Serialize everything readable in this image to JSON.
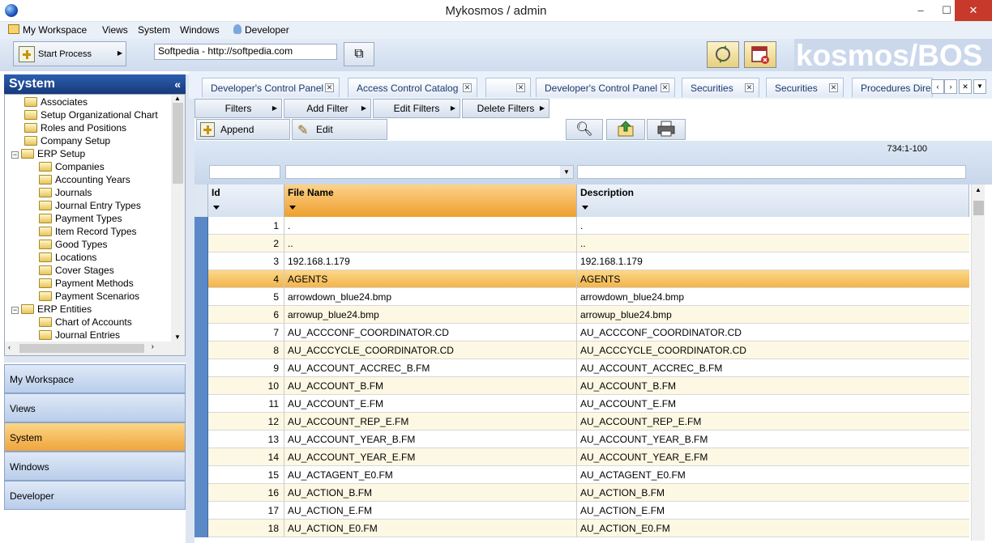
{
  "window": {
    "title": "Mykosmos / admin",
    "minimize": "–",
    "maximize": "☐",
    "close": "✕"
  },
  "menu": [
    "My Workspace",
    "Views",
    "System",
    "Windows",
    "Developer"
  ],
  "toolbar": {
    "start_process": "Start Process",
    "url": "Softpedia - http://softpedia.com",
    "brand": "kosmos/BOS"
  },
  "panel": {
    "title": "System",
    "collapse": "«"
  },
  "tree": [
    {
      "label": "Associates",
      "level": 1
    },
    {
      "label": "Setup Organizational Chart",
      "level": 1
    },
    {
      "label": "Roles and Positions",
      "level": 1
    },
    {
      "label": "Company Setup",
      "level": 1
    },
    {
      "label": "ERP Setup",
      "level": 0,
      "expander": "−"
    },
    {
      "label": "Companies",
      "level": 2
    },
    {
      "label": "Accounting Years",
      "level": 2
    },
    {
      "label": "Journals",
      "level": 2
    },
    {
      "label": "Journal Entry Types",
      "level": 2
    },
    {
      "label": "Payment Types",
      "level": 2
    },
    {
      "label": "Item Record Types",
      "level": 2
    },
    {
      "label": "Good Types",
      "level": 2
    },
    {
      "label": "Locations",
      "level": 2
    },
    {
      "label": "Cover Stages",
      "level": 2
    },
    {
      "label": "Payment Methods",
      "level": 2
    },
    {
      "label": "Payment Scenarios",
      "level": 2
    },
    {
      "label": "ERP Entities",
      "level": 0,
      "expander": "−"
    },
    {
      "label": "Chart of Accounts",
      "level": 2
    },
    {
      "label": "Journal Entries",
      "level": 2
    }
  ],
  "nav": [
    "My Workspace",
    "Views",
    "System",
    "Windows",
    "Developer"
  ],
  "nav_active": "System",
  "tabs": [
    "Developer's Control Panel",
    "Access Control Catalog",
    "",
    "Developer's Control Panel",
    "Securities",
    "Securities",
    "Procedures Directo"
  ],
  "filters": [
    "Filters",
    "Add Filter",
    "Edit Filters",
    "Delete Filters"
  ],
  "actions": {
    "append": "Append",
    "edit": "Edit"
  },
  "row_info": "734:1-100",
  "columns": [
    "Id",
    "File Name",
    "Description"
  ],
  "rows": [
    [
      "1",
      ".",
      "."
    ],
    [
      "2",
      "..",
      ".."
    ],
    [
      "3",
      "192.168.1.179",
      "192.168.1.179"
    ],
    [
      "4",
      "AGENTS",
      "AGENTS"
    ],
    [
      "5",
      "arrowdown_blue24.bmp",
      "arrowdown_blue24.bmp"
    ],
    [
      "6",
      "arrowup_blue24.bmp",
      "arrowup_blue24.bmp"
    ],
    [
      "7",
      "AU_ACCCONF_COORDINATOR.CD",
      "AU_ACCCONF_COORDINATOR.CD"
    ],
    [
      "8",
      "AU_ACCCYCLE_COORDINATOR.CD",
      "AU_ACCCYCLE_COORDINATOR.CD"
    ],
    [
      "9",
      "AU_ACCOUNT_ACCREC_B.FM",
      "AU_ACCOUNT_ACCREC_B.FM"
    ],
    [
      "10",
      "AU_ACCOUNT_B.FM",
      "AU_ACCOUNT_B.FM"
    ],
    [
      "11",
      "AU_ACCOUNT_E.FM",
      "AU_ACCOUNT_E.FM"
    ],
    [
      "12",
      "AU_ACCOUNT_REP_E.FM",
      "AU_ACCOUNT_REP_E.FM"
    ],
    [
      "13",
      "AU_ACCOUNT_YEAR_B.FM",
      "AU_ACCOUNT_YEAR_B.FM"
    ],
    [
      "14",
      "AU_ACCOUNT_YEAR_E.FM",
      "AU_ACCOUNT_YEAR_E.FM"
    ],
    [
      "15",
      "AU_ACTAGENT_E0.FM",
      "AU_ACTAGENT_E0.FM"
    ],
    [
      "16",
      "AU_ACTION_B.FM",
      "AU_ACTION_B.FM"
    ],
    [
      "17",
      "AU_ACTION_E.FM",
      "AU_ACTION_E.FM"
    ],
    [
      "18",
      "AU_ACTION_E0.FM",
      "AU_ACTION_E0.FM"
    ]
  ],
  "highlighted_row": "4"
}
